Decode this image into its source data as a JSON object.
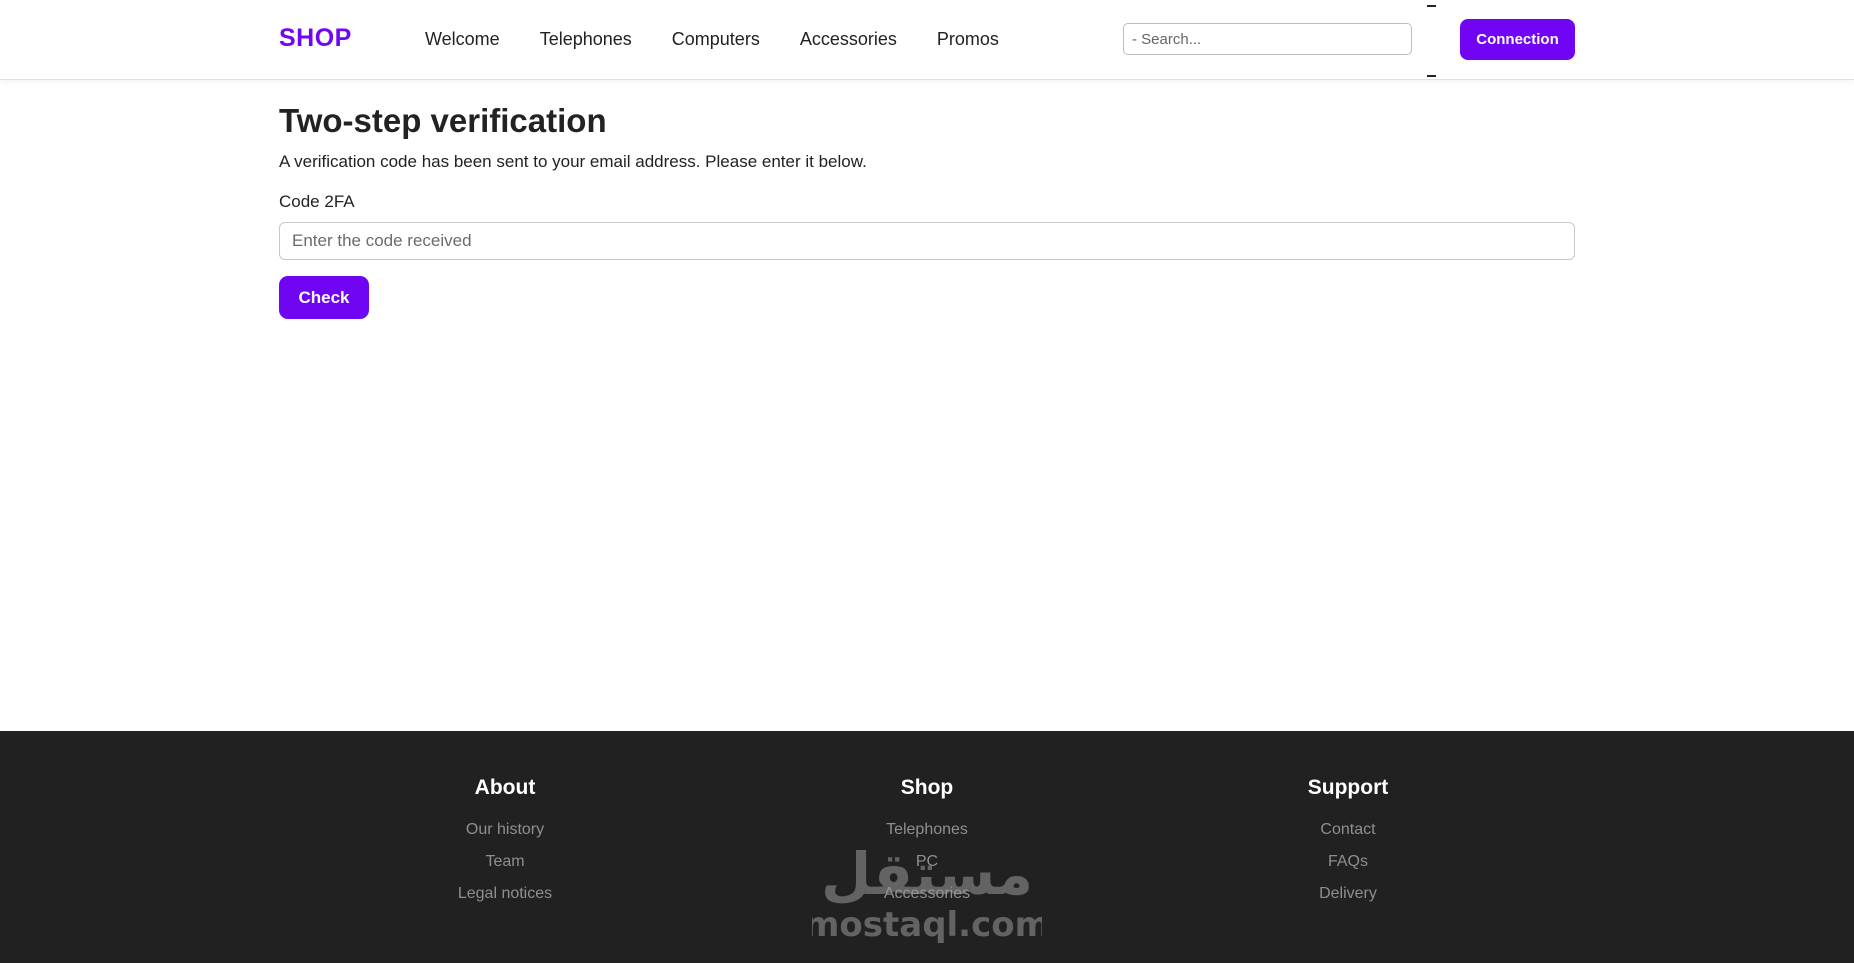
{
  "header": {
    "logo": "SHOP",
    "nav": [
      "Welcome",
      "Telephones",
      "Computers",
      "Accessories",
      "Promos"
    ],
    "search_placeholder": "- Search...",
    "connection_label": "Connection"
  },
  "main": {
    "title": "Two-step verification",
    "description": "A verification code has been sent to your email address. Please enter it below.",
    "code_label": "Code 2FA",
    "code_placeholder": "Enter the code received",
    "check_label": "Check"
  },
  "footer": {
    "about": {
      "title": "About",
      "links": [
        "Our history",
        "Team",
        "Legal notices"
      ]
    },
    "shop": {
      "title": "Shop",
      "links": [
        "Telephones",
        "PC",
        "Accessories"
      ]
    },
    "support": {
      "title": "Support",
      "links": [
        "Contact",
        "FAQs",
        "Delivery"
      ]
    }
  },
  "watermark": {
    "arabic": "مستقل",
    "latin": "mostaql.com"
  },
  "colors": {
    "accent": "#7005f4",
    "footer_bg": "#212121",
    "footer_link": "#8f8f8f"
  }
}
